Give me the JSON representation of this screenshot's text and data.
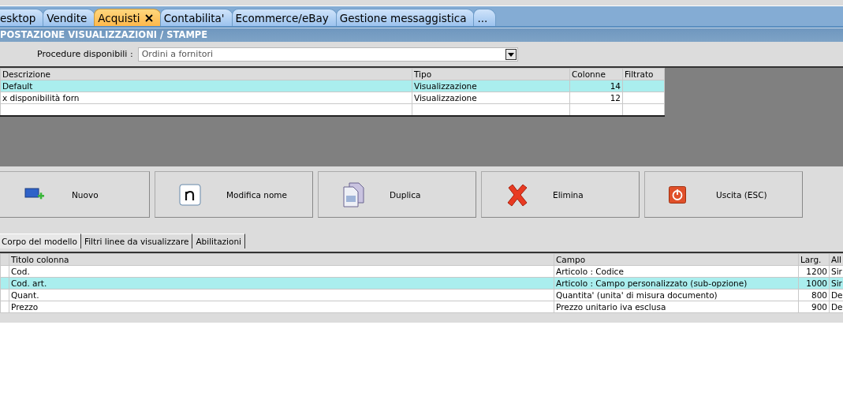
{
  "tabs": [
    {
      "label": "esktop",
      "selected": false,
      "closable": false
    },
    {
      "label": "Vendite",
      "selected": false,
      "closable": false
    },
    {
      "label": "Acquisti",
      "selected": true,
      "closable": true
    },
    {
      "label": "Contabilita'",
      "selected": false,
      "closable": false
    },
    {
      "label": "Ecommerce/eBay",
      "selected": false,
      "closable": false
    },
    {
      "label": "Gestione messaggistica",
      "selected": false,
      "closable": false
    },
    {
      "label": "...",
      "selected": false,
      "closable": false
    }
  ],
  "title": "POSTAZIONE VISUALIZZAZIONI / STAMPE",
  "procedure": {
    "label": "Procedure disponibili :",
    "value": "Ordini a fornitori"
  },
  "models_table": {
    "columns": [
      "Descrizione",
      "Tipo",
      "Colonne",
      "Filtrato"
    ],
    "rows": [
      {
        "cells": [
          "Default",
          "Visualizzazione",
          "14",
          ""
        ],
        "selected": true
      },
      {
        "cells": [
          "x disponibilità forn",
          "Visualizzazione",
          "12",
          ""
        ],
        "selected": false
      }
    ]
  },
  "buttons": [
    {
      "label": "Nuovo",
      "kind": "new"
    },
    {
      "label": "Modifica nome",
      "kind": "rename"
    },
    {
      "label": "Duplica",
      "kind": "duplicate"
    },
    {
      "label": "Elimina",
      "kind": "delete"
    },
    {
      "label": "Uscita (ESC)",
      "kind": "exit"
    }
  ],
  "sub_tabs": [
    {
      "label": "Corpo del modello",
      "selected": true
    },
    {
      "label": "Filtri linee da visualizzare",
      "selected": false
    },
    {
      "label": "Abilitazioni",
      "selected": false
    }
  ],
  "columns_table": {
    "columns": [
      "",
      "Titolo colonna",
      "Campo",
      "Larg.",
      "All"
    ],
    "rows": [
      {
        "cells": [
          "",
          "Cod.",
          "Articolo : Codice",
          "1200",
          "Sir"
        ],
        "selected": false
      },
      {
        "cells": [
          "",
          "Cod. art.",
          "Articolo : Campo personalizzato (sub-opzione)",
          "1000",
          "Sir"
        ],
        "selected": true
      },
      {
        "cells": [
          "",
          "Quant.",
          "Quantita' (unita' di misura documento)",
          "800",
          "De"
        ],
        "selected": false
      },
      {
        "cells": [
          "",
          "Prezzo",
          "Prezzo unitario iva esclusa",
          "900",
          "De"
        ],
        "selected": false
      }
    ]
  }
}
